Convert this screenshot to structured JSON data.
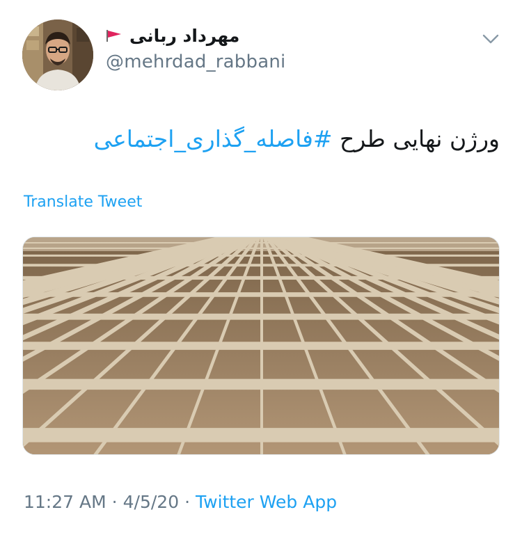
{
  "author": {
    "display_name": "مهرداد ربانی",
    "handle": "@mehrdad_rabbani",
    "flag_icon": "red-flag-icon",
    "flag_color": "#e0245e"
  },
  "tweet": {
    "text_plain": "ورژن نهایی طرح ",
    "hashtag": "#فاصله_گذاری_اجتماعی"
  },
  "translate_label": "Translate Tweet",
  "meta": {
    "time": "11:27 AM",
    "separator": "·",
    "date": "4/5/20",
    "source": "Twitter Web App"
  },
  "icons": {
    "menu": "chevron-down-icon"
  },
  "colors": {
    "link": "#1da1f2",
    "secondary_text": "#657786",
    "primary_text": "#14171a"
  }
}
